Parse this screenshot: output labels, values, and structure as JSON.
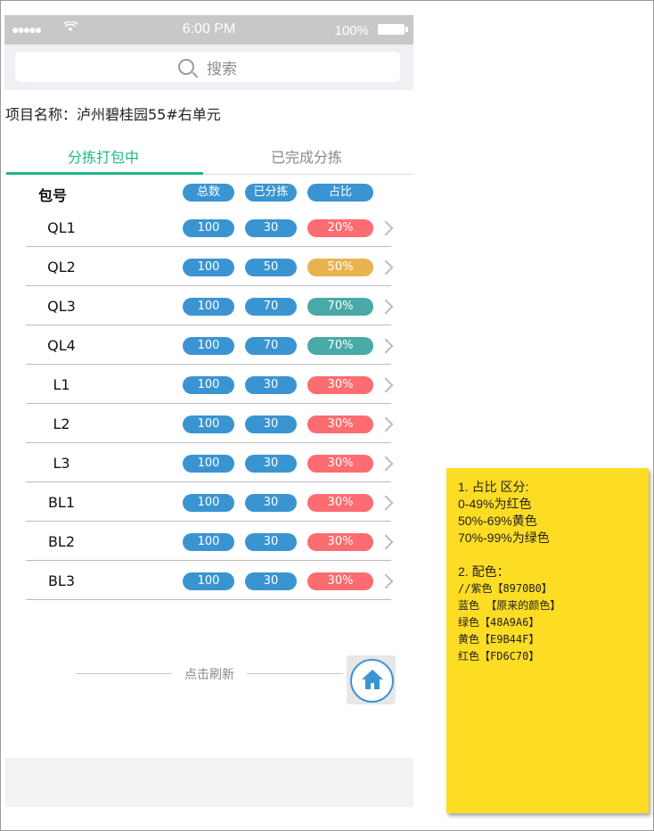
{
  "status": {
    "signal": "●●●●●",
    "time": "6:00 PM",
    "battery_pct": "100%"
  },
  "search": {
    "placeholder": "搜索"
  },
  "project": {
    "label": "项目名称：泸州碧桂园55#右单元"
  },
  "tabs": [
    {
      "label": "分拣打包中",
      "active": true
    },
    {
      "label": "已完成分拣",
      "active": false
    }
  ],
  "table": {
    "headers": {
      "pkg": "包号",
      "total": "总数",
      "sorted": "已分拣",
      "ratio": "占比"
    },
    "rows": [
      {
        "pkg": "QL1",
        "total": "100",
        "sorted": "30",
        "ratio": "20%",
        "color": "#FD6C70"
      },
      {
        "pkg": "QL2",
        "total": "100",
        "sorted": "50",
        "ratio": "50%",
        "color": "#E9B44F"
      },
      {
        "pkg": "QL3",
        "total": "100",
        "sorted": "70",
        "ratio": "70%",
        "color": "#48A9A6"
      },
      {
        "pkg": "QL4",
        "total": "100",
        "sorted": "70",
        "ratio": "70%",
        "color": "#48A9A6"
      },
      {
        "pkg": "L1",
        "total": "100",
        "sorted": "30",
        "ratio": "30%",
        "color": "#FD6C70"
      },
      {
        "pkg": "L2",
        "total": "100",
        "sorted": "30",
        "ratio": "30%",
        "color": "#FD6C70"
      },
      {
        "pkg": "L3",
        "total": "100",
        "sorted": "30",
        "ratio": "30%",
        "color": "#FD6C70"
      },
      {
        "pkg": "BL1",
        "total": "100",
        "sorted": "30",
        "ratio": "30%",
        "color": "#FD6C70"
      },
      {
        "pkg": "BL2",
        "total": "100",
        "sorted": "30",
        "ratio": "30%",
        "color": "#FD6C70"
      },
      {
        "pkg": "BL3",
        "total": "100",
        "sorted": "30",
        "ratio": "30%",
        "color": "#FD6C70"
      }
    ]
  },
  "refresh": {
    "label": "点击刷新"
  },
  "note": {
    "lines": [
      "1. 占比 区分:",
      "0-49%为红色",
      "50%-69%黄色",
      "70%-99%为绿色",
      "",
      "2. 配色：",
      "//紫色【8970B0】",
      "蓝色 【原来的颜色】",
      "绿色【48A9A6】",
      "黄色【E9B44F】",
      "红色【FD6C70】"
    ]
  },
  "colors": {
    "blue": "#3b94d2",
    "green": "#20b68b",
    "note_bg": "#fddc24"
  }
}
